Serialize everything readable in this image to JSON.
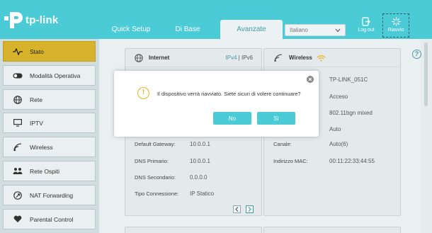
{
  "brand": {
    "name": "tp-link"
  },
  "tabs": [
    {
      "label": "Quick Setup"
    },
    {
      "label": "Di Base"
    },
    {
      "label": "Avanzate"
    }
  ],
  "language": {
    "selected": "Italiano"
  },
  "header_buttons": {
    "logout": "Log out",
    "reboot": "Riavvio"
  },
  "sidebar": {
    "items": [
      {
        "label": "Stato",
        "icon": "pulse-icon",
        "active": true
      },
      {
        "label": "Modalità Operativa",
        "icon": "toggle-icon"
      },
      {
        "label": "Rete",
        "icon": "globe-icon"
      },
      {
        "label": "IPTV",
        "icon": "monitor-icon"
      },
      {
        "label": "Wireless",
        "icon": "wifi-icon"
      },
      {
        "label": "Rete Ospiti",
        "icon": "users-icon"
      },
      {
        "label": "NAT Forwarding",
        "icon": "nat-icon"
      },
      {
        "label": "Parental Control",
        "icon": "heart-icon"
      }
    ]
  },
  "internet": {
    "title": "Internet",
    "ipv4": "IPv4",
    "sep": "|",
    "ipv6": "IPv6",
    "fields": [
      {
        "label": "Default Gateway:",
        "value": "10.0.0.1"
      },
      {
        "label": "DNS Primario:",
        "value": "10.0.0.1"
      },
      {
        "label": "DNS Secondario:",
        "value": "0.0.0.0"
      },
      {
        "label": "Tipo Connessione:",
        "value": "IP Statico"
      }
    ]
  },
  "wireless": {
    "title": "Wireless",
    "visible_values": [
      "TP-LINK_051C",
      "Acceso",
      "802.11bgn mixed",
      "Auto"
    ],
    "fields": [
      {
        "label": "Canale:",
        "value": "Auto(6)"
      },
      {
        "label": "Indirizzo MAC:",
        "value": "00:11:22:33:44:55"
      }
    ]
  },
  "dialog": {
    "message": "Il dispositivo verrà riavviato. Siete sicuri di volere continuare?",
    "no_label": "No",
    "yes_label": "Sì"
  },
  "colors": {
    "accent": "#4acbd6",
    "active_nav": "#d6b32a",
    "warning": "#e8b320"
  }
}
